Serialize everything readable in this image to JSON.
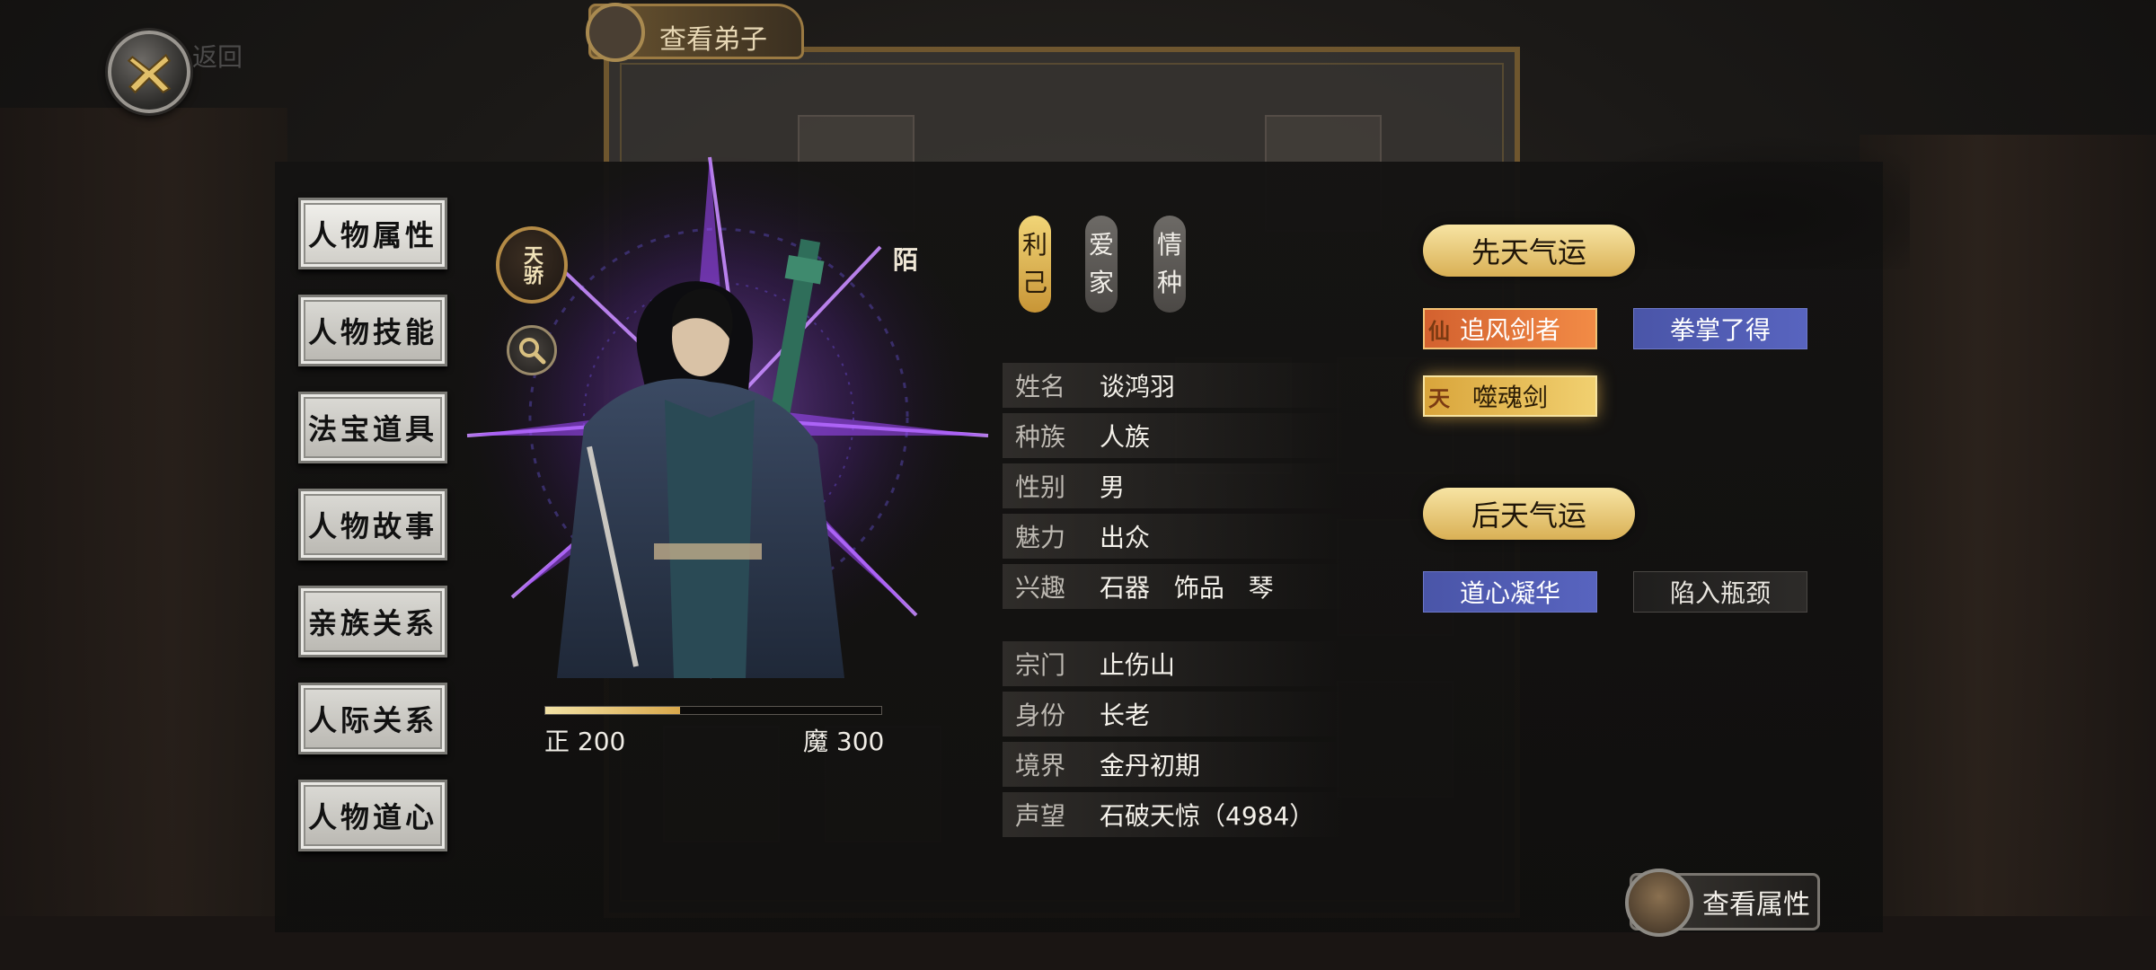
{
  "background": {
    "back_panel_title": "查看弟子",
    "close_caption": "返回"
  },
  "menu": {
    "items": [
      {
        "label": "人物属性",
        "active": true
      },
      {
        "label": "人物技能",
        "active": false
      },
      {
        "label": "法宝道具",
        "active": false
      },
      {
        "label": "人物故事",
        "active": false
      },
      {
        "label": "亲族关系",
        "active": false
      },
      {
        "label": "人际关系",
        "active": false
      },
      {
        "label": "人物道心",
        "active": false
      }
    ]
  },
  "portrait": {
    "rank_badge": "天骄",
    "side_name": "陌",
    "alignment": {
      "righteous_label": "正 200",
      "demonic_label": "魔 300",
      "righteous_fraction": 0.4
    }
  },
  "tags": [
    {
      "text": "利己",
      "style": "gold"
    },
    {
      "text": "爱家",
      "style": "gray"
    },
    {
      "text": "情种",
      "style": "gray"
    }
  ],
  "info": [
    {
      "label": "姓名",
      "value": "谈鸿羽"
    },
    {
      "label": "种族",
      "value": "人族"
    },
    {
      "label": "性别",
      "value": "男"
    },
    {
      "label": "魅力",
      "value": "出众"
    },
    {
      "label": "兴趣",
      "value": "石器 饰品 琴"
    },
    {
      "label": "宗门",
      "value": "止伤山"
    },
    {
      "label": "身份",
      "value": "长老"
    },
    {
      "label": "境界",
      "value": "金丹初期"
    },
    {
      "label": "声望",
      "value": "石破天惊（4984）"
    }
  ],
  "innate_luck": {
    "title": "先天气运",
    "traits": [
      {
        "text": "追风剑者",
        "style": "orange",
        "icon": "仙"
      },
      {
        "text": "拳掌了得",
        "style": "blue",
        "icon": ""
      },
      {
        "text": "噬魂剑",
        "style": "goldtrait",
        "icon": "天"
      }
    ]
  },
  "acquired_luck": {
    "title": "后天气运",
    "traits": [
      {
        "text": "道心凝华",
        "style": "blue"
      },
      {
        "text": "陷入瓶颈",
        "style": "dark"
      }
    ]
  },
  "view_attributes_label": "查看属性",
  "colors": {
    "gold": "#d9b055",
    "orange": "#f28b46",
    "blue": "#5864bf",
    "purple_glow": "#9b4dff"
  }
}
